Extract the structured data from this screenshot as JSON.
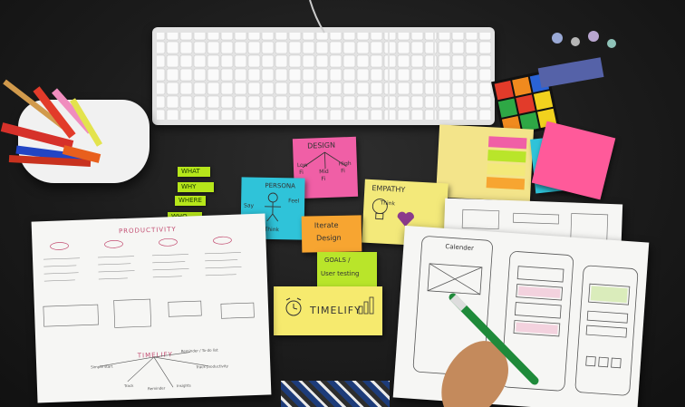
{
  "scene": {
    "title": "",
    "sticky_notes": {
      "design": {
        "title": "DESIGN",
        "words": [
          "Low",
          "Fi",
          "Mid",
          "Fi",
          "High",
          "Fi"
        ]
      },
      "persona": {
        "title": "PERSONA",
        "words": [
          "Feel",
          "Say",
          "Think"
        ]
      },
      "empathy": {
        "title": "EMPATHY",
        "words": [
          "Think"
        ]
      },
      "iterate": {
        "line1": "Iterate",
        "line2": "Design"
      },
      "goals": {
        "line1": "GOALS /",
        "line2": "User testing"
      },
      "timelify": {
        "label": "TIMELIFY"
      }
    },
    "tags": [
      "WHAT",
      "WHY",
      "WHERE",
      "WHO"
    ],
    "productivity_sheet": {
      "heading": "PRODUCTIVITY",
      "brand": "TIMELIFY",
      "bottom_labels": [
        "Simple start",
        "Track",
        "Reminder / To-do list",
        "Track productivity",
        "Reminder",
        "Insights"
      ]
    },
    "wireframe_sheet": {
      "label": "Calender"
    }
  },
  "colors": {
    "design_note": "#f05fa6",
    "persona_note": "#2fc3d9",
    "empathy_note": "#f3e97a",
    "iterate_note": "#f7a531",
    "goals_note": "#b9e52a",
    "timelify_note": "#f6ea6e",
    "pink_pad": "#ff5a9a",
    "tag_green": "#b6e61a"
  }
}
